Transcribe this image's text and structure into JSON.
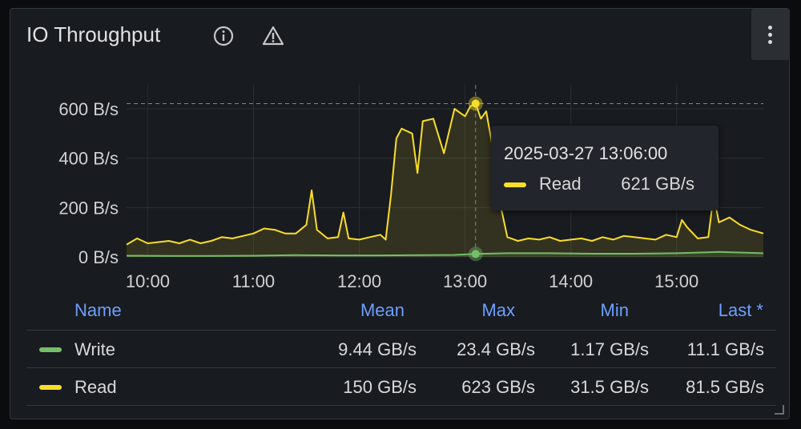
{
  "panel": {
    "title": "IO Throughput",
    "header_icons": [
      "info-icon",
      "warning-icon"
    ],
    "menu_icon": "kebab-menu-icon"
  },
  "chart_data": {
    "type": "line",
    "x_ticks": [
      "10:00",
      "11:00",
      "12:00",
      "13:00",
      "14:00",
      "15:00"
    ],
    "y_ticks": [
      "0 B/s",
      "200 B/s",
      "400 B/s",
      "600 B/s"
    ],
    "ylim": [
      0,
      600
    ],
    "unit": "GB/s",
    "x_range_hours": [
      9.8,
      15.82
    ],
    "grid": true,
    "colors": {
      "Write": "#73bf69",
      "Read": "#fade2a"
    },
    "series": [
      {
        "name": "Write",
        "x": [
          9.8,
          10.2,
          10.6,
          11.0,
          11.4,
          11.8,
          12.2,
          12.6,
          12.9,
          13.1,
          13.4,
          13.8,
          14.2,
          14.6,
          15.0,
          15.4,
          15.82
        ],
        "values": [
          5,
          4,
          4,
          5,
          7,
          6,
          6,
          7,
          8,
          12,
          15,
          15,
          13,
          13,
          15,
          20,
          15
        ]
      },
      {
        "name": "Read",
        "x": [
          9.8,
          9.9,
          10.0,
          10.1,
          10.2,
          10.3,
          10.4,
          10.5,
          10.6,
          10.7,
          10.8,
          10.9,
          11.0,
          11.1,
          11.2,
          11.3,
          11.4,
          11.5,
          11.55,
          11.6,
          11.7,
          11.8,
          11.85,
          11.9,
          12.0,
          12.1,
          12.2,
          12.25,
          12.3,
          12.35,
          12.4,
          12.5,
          12.55,
          12.6,
          12.7,
          12.8,
          12.9,
          13.0,
          13.05,
          13.1,
          13.15,
          13.2,
          13.25,
          13.3,
          13.35,
          13.4,
          13.5,
          13.6,
          13.7,
          13.8,
          13.9,
          14.0,
          14.1,
          14.2,
          14.3,
          14.4,
          14.5,
          14.6,
          14.7,
          14.8,
          14.9,
          15.0,
          15.05,
          15.1,
          15.2,
          15.3,
          15.35,
          15.4,
          15.5,
          15.6,
          15.7,
          15.82
        ],
        "values": [
          50,
          75,
          55,
          60,
          65,
          55,
          70,
          55,
          65,
          80,
          75,
          85,
          95,
          115,
          110,
          95,
          95,
          130,
          270,
          110,
          75,
          80,
          180,
          75,
          70,
          80,
          90,
          70,
          250,
          480,
          520,
          500,
          340,
          550,
          560,
          420,
          600,
          570,
          610,
          621,
          560,
          590,
          470,
          270,
          180,
          80,
          65,
          75,
          70,
          80,
          65,
          70,
          75,
          65,
          80,
          70,
          85,
          80,
          75,
          70,
          90,
          80,
          150,
          120,
          75,
          80,
          250,
          140,
          160,
          130,
          110,
          95
        ]
      }
    ]
  },
  "tooltip": {
    "time": "2025-03-27 13:06:00",
    "series": "Read",
    "value": "621 GB/s",
    "at_hours": 13.1
  },
  "legend": {
    "headers": {
      "name": "Name",
      "mean": "Mean",
      "max": "Max",
      "min": "Min",
      "last": "Last *"
    },
    "rows": [
      {
        "name": "Write",
        "mean": "9.44 GB/s",
        "max": "23.4 GB/s",
        "min": "1.17 GB/s",
        "last": "11.1 GB/s"
      },
      {
        "name": "Read",
        "mean": "150 GB/s",
        "max": "623 GB/s",
        "min": "31.5 GB/s",
        "last": "81.5 GB/s"
      }
    ]
  }
}
